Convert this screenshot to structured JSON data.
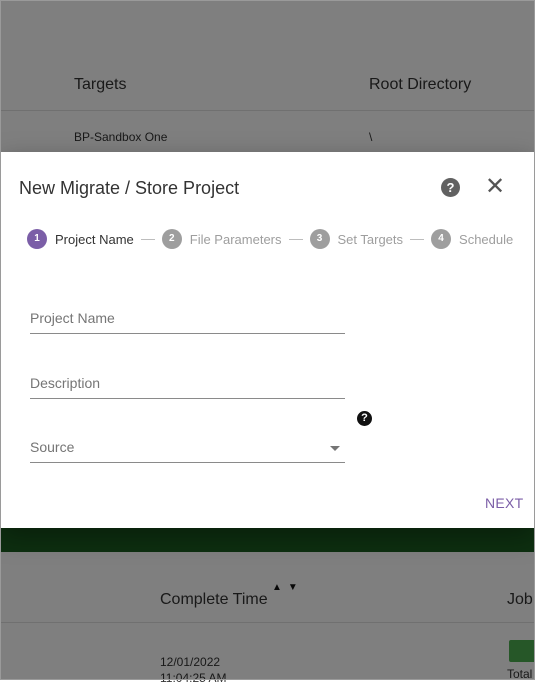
{
  "background": {
    "columns": {
      "targets": "Targets",
      "root_directory": "Root Directory"
    },
    "row1": {
      "target": "BP-Sandbox One",
      "root": "\\"
    },
    "lower_table": {
      "complete_time_header": "Complete Time",
      "sort_glyphs": "▲▼",
      "job_header": "Job",
      "date": "12/01/2022",
      "time": "11:04:25 AM",
      "total_label": "Total"
    }
  },
  "dialog": {
    "title": "New Migrate / Store Project",
    "help_glyph": "?",
    "close_glyph": "✕",
    "steps": [
      {
        "number": "1",
        "label": "Project Name",
        "active": true
      },
      {
        "number": "2",
        "label": "File Parameters",
        "active": false
      },
      {
        "number": "3",
        "label": "Set Targets",
        "active": false
      },
      {
        "number": "4",
        "label": "Schedule",
        "active": false
      }
    ],
    "fields": {
      "project_name": {
        "label": "Project Name"
      },
      "description": {
        "label": "Description"
      },
      "source": {
        "label": "Source"
      }
    },
    "source_help_glyph": "?",
    "next_label": "NEXT"
  },
  "colors": {
    "accent": "#7b5ea7",
    "inactive_step": "#9e9e9e",
    "footer_green": "#1b5e20",
    "chip_green": "#4caf50"
  }
}
